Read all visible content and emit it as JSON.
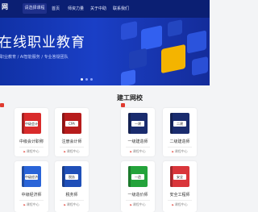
{
  "header": {
    "logo": "网",
    "site_select": "请选择课程",
    "nav": [
      "首页",
      "师资力量",
      "关于中助",
      "联系我们"
    ]
  },
  "hero": {
    "title": "在线职业教育",
    "subtitle": "职业教育 / AI智能服务 / 专业答疑团队"
  },
  "section": {
    "title": "建工网校"
  },
  "cards": [
    {
      "name": "中级会计职称",
      "badge": "中级会计",
      "link": "课程中心",
      "color": "#d92b2b"
    },
    {
      "name": "注册会计师",
      "badge": "CPA",
      "link": "课程中心",
      "color": "#b71c1c"
    },
    {
      "name": "一级建造师",
      "badge": "一建",
      "link": "课程中心",
      "color": "#1a2c6e"
    },
    {
      "name": "二级建造师",
      "badge": "二建",
      "link": "课程中心",
      "color": "#1a2c6e"
    },
    {
      "name": "中级经济师",
      "badge": "中级经济",
      "link": "课程中心",
      "color": "#2a64d8"
    },
    {
      "name": "税务师",
      "badge": "税务",
      "link": "课程中心",
      "color": "#1f4fb8"
    },
    {
      "name": "一级造价师",
      "badge": "一造",
      "link": "课程中心",
      "color": "#24a33b"
    },
    {
      "name": "安全工程师",
      "badge": "安全",
      "link": "课程中心",
      "color": "#d9363b"
    }
  ]
}
